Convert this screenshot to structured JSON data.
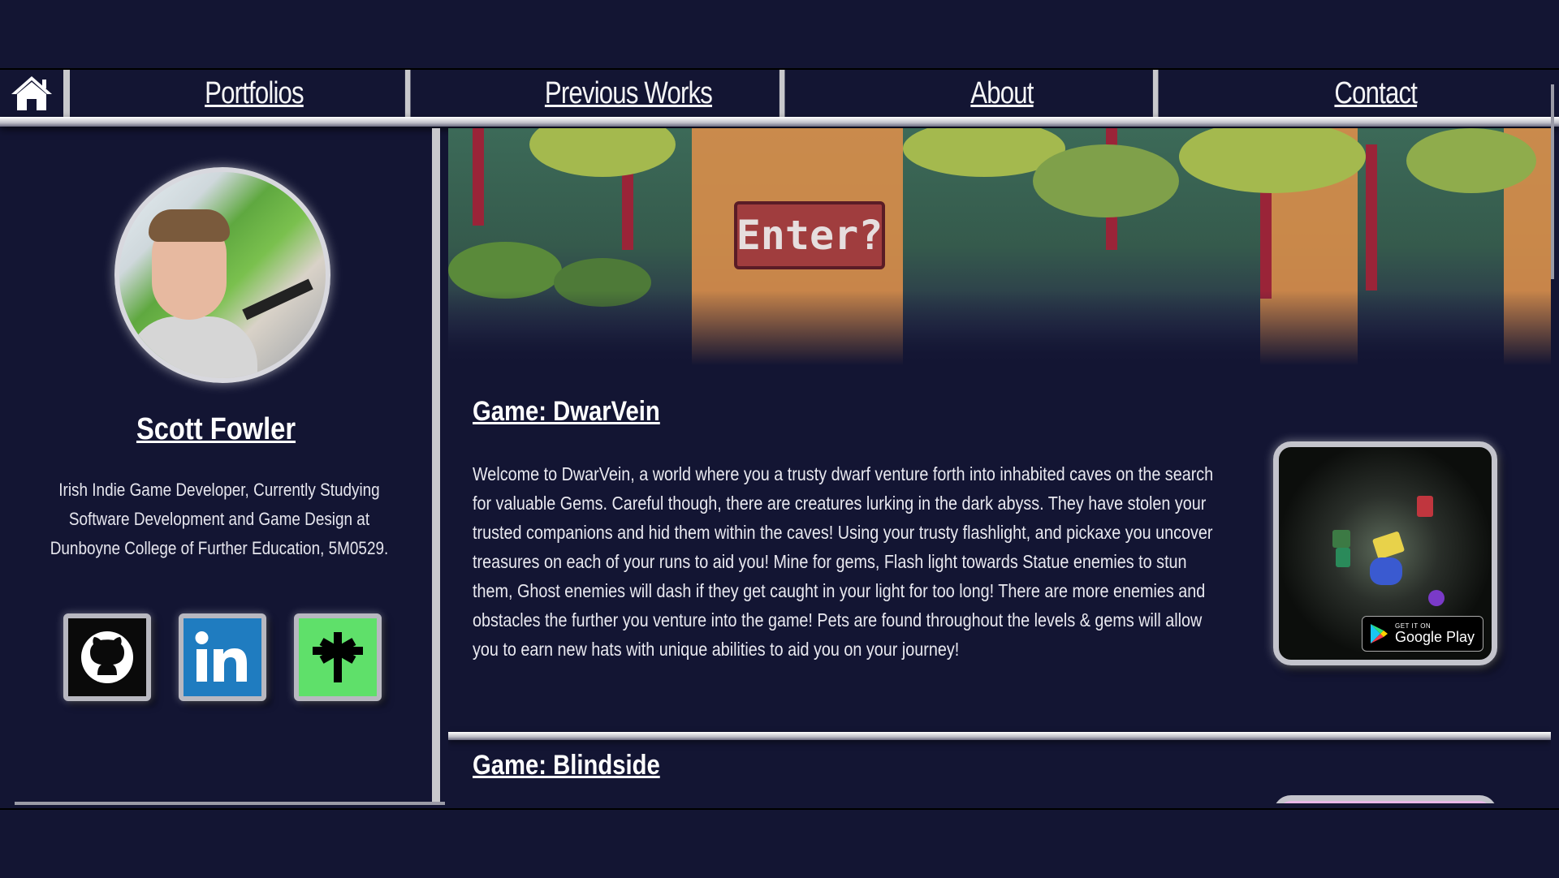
{
  "nav": {
    "home_icon": "home-icon",
    "items": [
      {
        "label": "Portfolios"
      },
      {
        "label": "Previous Works"
      },
      {
        "label": "About"
      },
      {
        "label": "Contact"
      }
    ]
  },
  "profile": {
    "name": "Scott Fowler",
    "bio": "Irish Indie Game Developer, Currently Studying Software Development and Game Design at Dunboyne College of Further Education, 5M0529.",
    "socials": [
      {
        "icon": "github-icon",
        "color": "#0a0a0a"
      },
      {
        "icon": "linkedin-icon",
        "color": "#1f7cc0"
      },
      {
        "icon": "linktree-icon",
        "color": "#5fe06a"
      }
    ]
  },
  "banner": {
    "sign_text": "Enter?"
  },
  "games": [
    {
      "title": "Game: DwarVein",
      "description": "Welcome to DwarVein, a world where you a trusty dwarf venture forth into inhabited caves on the search for valuable Gems. Careful though, there are creatures lurking in the dark abyss. They have stolen your trusted companions and hid them within the caves! Using your trusty flashlight, and pickaxe you uncover treasures on each of your runs to aid you! Mine for gems, Flash light towards Statue enemies to stun them, Ghost enemies will dash if they get caught in your light for too long! There are more enemies and obstacles the further you venture into the game! Pets are found throughout the levels & gems will allow you to earn new hats with unique abilities to aid you on your journey!",
      "badge": {
        "small": "GET IT ON",
        "big": "Google Play"
      }
    },
    {
      "title": "Game: Blindside"
    }
  ],
  "colors": {
    "background": "#131533",
    "rule": "#c8c8cc",
    "text": "#e8e8ef"
  }
}
